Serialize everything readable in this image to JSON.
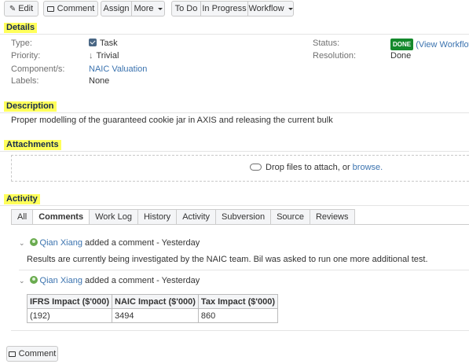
{
  "toolbar": {
    "edit": "Edit",
    "comment": "Comment",
    "assign": "Assign",
    "more": "More",
    "todo": "To Do",
    "in_progress": "In Progress",
    "workflow": "Workflow"
  },
  "details": {
    "title": "Details",
    "type_label": "Type:",
    "type_value": "Task",
    "priority_label": "Priority:",
    "priority_value": "Trivial",
    "components_label": "Component/s:",
    "components_value": "NAIC Valuation",
    "labels_label": "Labels:",
    "labels_value": "None",
    "status_label": "Status:",
    "status_value": "DONE",
    "status_link": "(View Workflow)",
    "resolution_label": "Resolution:",
    "resolution_value": "Done"
  },
  "description": {
    "title": "Description",
    "text": "Proper modelling of the guaranteed cookie jar in AXIS and releasing the current bulk"
  },
  "attachments": {
    "title": "Attachments",
    "drop_text": "Drop files to attach, or",
    "browse": "browse."
  },
  "activity": {
    "title": "Activity",
    "tabs": [
      "All",
      "Comments",
      "Work Log",
      "History",
      "Activity",
      "Subversion",
      "Source",
      "Reviews"
    ],
    "comments": [
      {
        "author": "Qian Xiang",
        "action": "added a comment - Yesterday",
        "body": "Results are currently being investigated by the NAIC team. Bil was asked to run one more additional test."
      },
      {
        "author": "Qian Xiang",
        "action": "added a comment - Yesterday",
        "table": {
          "headers": [
            "IFRS Impact ($'000)",
            "NAIC Impact ($'000)",
            "Tax Impact ($'000)"
          ],
          "row": [
            "(192)",
            "3494",
            "860"
          ]
        }
      }
    ]
  },
  "footer": {
    "comment": "Comment"
  }
}
